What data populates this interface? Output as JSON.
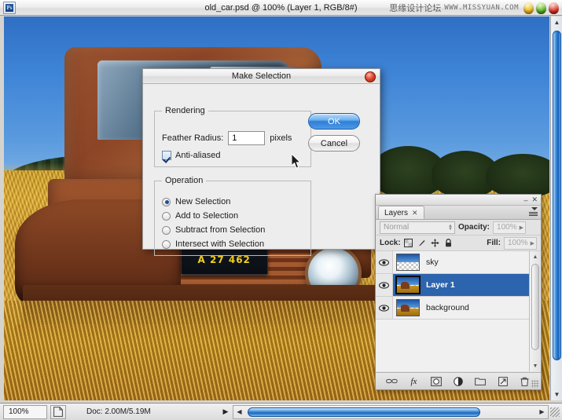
{
  "window": {
    "app_icon": "photoshop-document-icon",
    "title": "old_car.psd @ 100% (Layer 1, RGB/8#)",
    "watermark_cn": "思缘设计论坛",
    "watermark_url": "WWW.MISSYUAN.COM"
  },
  "photo": {
    "license_plate": "A 27 462"
  },
  "dialog": {
    "title": "Make Selection",
    "close_icon": "close-icon",
    "rendering": {
      "legend": "Rendering",
      "feather_label": "Feather Radius:",
      "feather_value": "1",
      "feather_units": "pixels",
      "antialiased_label": "Anti-aliased",
      "antialiased_checked": true
    },
    "operation": {
      "legend": "Operation",
      "options": [
        {
          "label": "New Selection",
          "selected": true
        },
        {
          "label": "Add to Selection",
          "selected": false
        },
        {
          "label": "Subtract from Selection",
          "selected": false
        },
        {
          "label": "Intersect with Selection",
          "selected": false
        }
      ]
    },
    "buttons": {
      "ok": "OK",
      "cancel": "Cancel"
    }
  },
  "layers_panel": {
    "tab_label": "Layers",
    "tab_close": "✕",
    "minimize": "–",
    "close": "✕",
    "blend_mode": "Normal",
    "opacity_label": "Opacity:",
    "opacity_value": "100%",
    "lock_label": "Lock:",
    "fill_label": "Fill:",
    "fill_value": "100%",
    "lock_icons": [
      "lock-transparency-icon",
      "lock-image-icon",
      "lock-position-icon",
      "lock-all-icon"
    ],
    "rows": [
      {
        "name": "sky",
        "selected": false,
        "visible": true,
        "thumb": "sky"
      },
      {
        "name": "Layer 1",
        "selected": true,
        "visible": true,
        "thumb": "truck"
      },
      {
        "name": "background",
        "selected": false,
        "visible": true,
        "thumb": "truck"
      }
    ],
    "bottom_icons": [
      "link-layers-icon",
      "layer-style-fx-icon",
      "layer-mask-icon",
      "adjustment-layer-icon",
      "new-group-icon",
      "new-layer-icon",
      "delete-layer-icon"
    ]
  },
  "statusbar": {
    "zoom": "100%",
    "proxy_icon": "document-proxy-icon",
    "doc_info": "Doc: 2.00M/5.19M",
    "expand_arrow": "▶"
  }
}
